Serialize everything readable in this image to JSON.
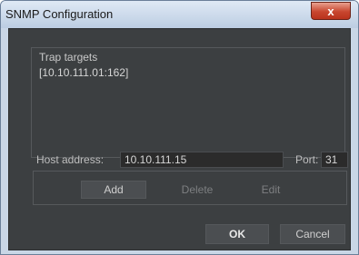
{
  "window": {
    "title": "SNMP Configuration",
    "close_glyph": "x"
  },
  "trap": {
    "label": "Trap targets",
    "items": [
      "[10.10.111.01:162]"
    ]
  },
  "host": {
    "label": "Host address:",
    "value": "10.10.111.15",
    "port_label": "Port:",
    "port_value": "31"
  },
  "actions": {
    "add": "Add",
    "delete": "Delete",
    "edit": "Edit"
  },
  "dialog": {
    "ok": "OK",
    "cancel": "Cancel"
  },
  "colors": {
    "client_bg": "#3c3f41",
    "titlebar": "#c9d6e6",
    "close_button": "#c8462f"
  }
}
